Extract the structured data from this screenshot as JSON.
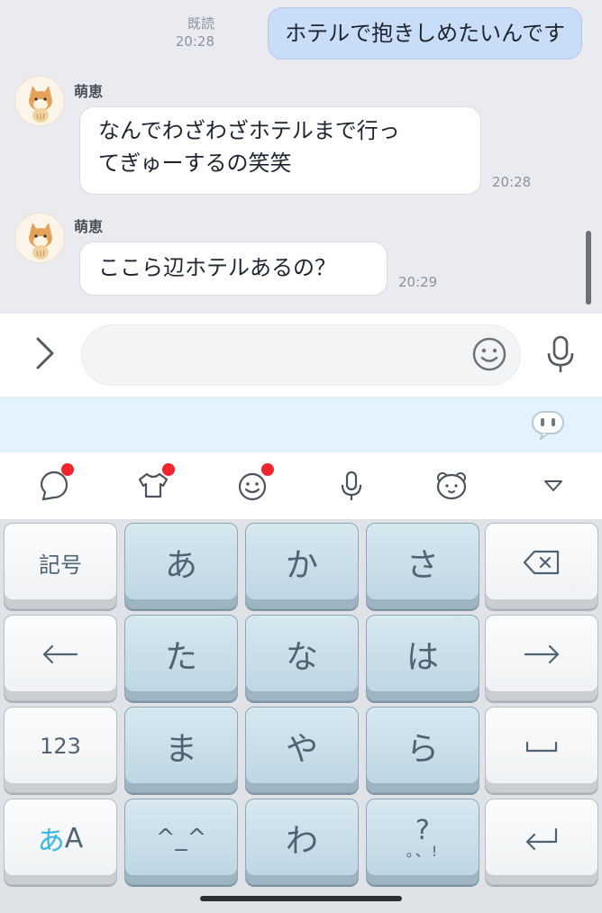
{
  "chat": {
    "outgoing": {
      "text": "ホテルで抱きしめたいんです",
      "read_label": "既読",
      "time": "20:28"
    },
    "incoming": [
      {
        "sender": "萌恵",
        "lines": [
          "なんでわざわざホテルまで行っ",
          "てぎゅーするの笑笑"
        ],
        "time": "20:28"
      },
      {
        "sender": "萌恵",
        "lines": [
          "ここら辺ホテルあるの？"
        ],
        "time": "20:29"
      }
    ]
  },
  "input": {
    "placeholder": "",
    "value": ""
  },
  "toolbar": {
    "icons": [
      "chat-bubble-icon",
      "shirt-icon",
      "smiley-icon",
      "mic-icon",
      "bear-face-icon",
      "triangle-down-icon"
    ],
    "notification_color": "#f2242e"
  },
  "keyboard": {
    "rows": [
      [
        "記号",
        "あ",
        "か",
        "さ",
        "⌫"
      ],
      [
        "←",
        "た",
        "な",
        "は",
        "→"
      ],
      [
        "123",
        "ま",
        "や",
        "ら",
        "␣"
      ],
      [
        "あA",
        "^_^",
        "わ",
        "?。、!",
        "⏎"
      ]
    ],
    "mode_label_kana": "あ",
    "mode_label_alpha": "A",
    "emoticon_label": "^_^",
    "punct_top": "?",
    "punct_bottom": "。、!"
  },
  "colors": {
    "outgoing_bubble": "#c9dcf8",
    "chat_bg": "#e9ebf0",
    "suggest_bar": "#e3f3fd",
    "kana_key": "#c8dde8"
  }
}
